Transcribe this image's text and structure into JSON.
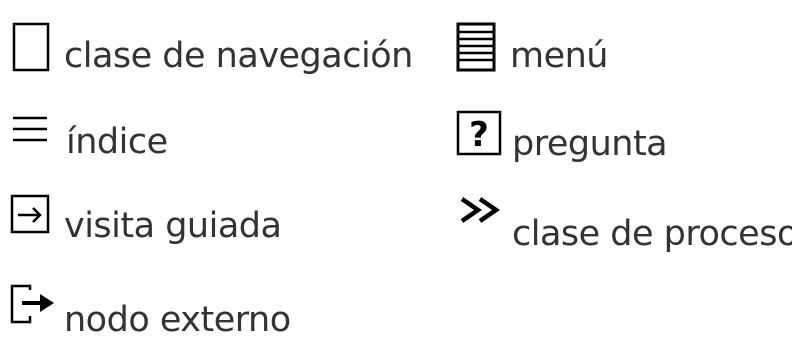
{
  "legend": {
    "items": [
      {
        "icon": "navigation-class-icon",
        "label": "clase de navegación"
      },
      {
        "icon": "menu-icon",
        "label": "menú"
      },
      {
        "icon": "index-icon",
        "label": "índice"
      },
      {
        "icon": "question-icon",
        "label": "pregunta"
      },
      {
        "icon": "guided-tour-icon",
        "label": "visita guiada"
      },
      {
        "icon": "process-class-icon",
        "label": "clase de proceso"
      },
      {
        "icon": "external-node-icon",
        "label": "nodo externo"
      }
    ]
  },
  "colors": {
    "text": "#333333",
    "icon": "#000000",
    "background": "#ffffff"
  }
}
